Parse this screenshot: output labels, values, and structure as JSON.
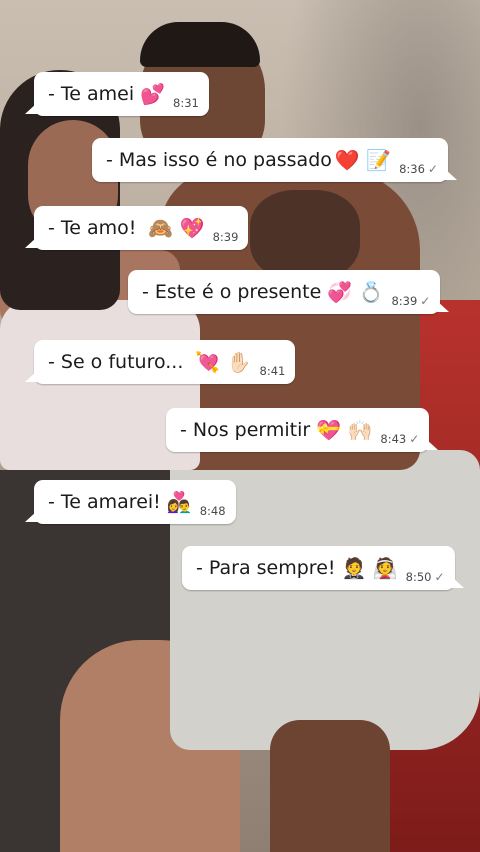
{
  "colors": {
    "bubble": "#ffffff",
    "text": "#1b1b1b",
    "time": "#4a4a4a",
    "tick": "#7b7b7b",
    "sofa": "#b8322d"
  },
  "messages": [
    {
      "direction": "in",
      "text": "- Te amei",
      "emoji": "💕",
      "time": "8:31",
      "read_tick": ""
    },
    {
      "direction": "out",
      "text": "- Mas isso é no passado",
      "emoji": "❤️ 📝",
      "time": "8:36",
      "read_tick": "✓"
    },
    {
      "direction": "in",
      "text": "-  Te amo!",
      "emoji": "🙈 💖",
      "time": "8:39",
      "read_tick": ""
    },
    {
      "direction": "out",
      "text": "- Este é o presente",
      "emoji": "💞 💍",
      "time": "8:39",
      "read_tick": "✓"
    },
    {
      "direction": "in",
      "text": "-  Se o futuro...",
      "emoji": "💘 ✋🏻",
      "time": "8:41",
      "read_tick": ""
    },
    {
      "direction": "out",
      "text": "-  Nos permitir",
      "emoji": "💝 🙌🏻",
      "time": "8:43",
      "read_tick": "✓"
    },
    {
      "direction": "in",
      "text": "- Te amarei!",
      "emoji": "👩‍❤️‍👨",
      "time": "8:48",
      "read_tick": ""
    },
    {
      "direction": "out",
      "text": "- Para sempre!",
      "emoji": "🤵 👰",
      "time": "8:50",
      "read_tick": "✓"
    }
  ]
}
